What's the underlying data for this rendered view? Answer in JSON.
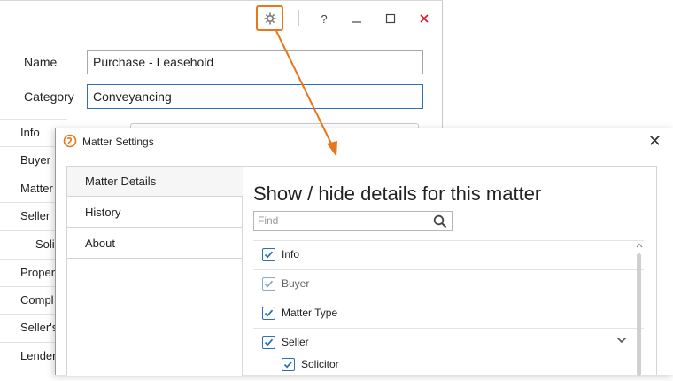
{
  "back_window": {
    "title_buttons": {
      "settings_icon": "gear-icon",
      "help_label": "?",
      "minimize_label": "—",
      "maximize_label": "☐",
      "close_label": "✕",
      "close_color": "#e81123"
    },
    "form": {
      "name_label": "Name",
      "name_value": "Purchase - Leasehold",
      "category_label": "Category",
      "category_value": "Conveyancing"
    },
    "left_list": [
      "Info",
      "Buyer",
      "Matter",
      "Seller",
      "Solic",
      "Proper",
      "Compl",
      "Seller's",
      "Lender"
    ]
  },
  "callout": {
    "color": "#e8761b"
  },
  "dialog": {
    "title": "Matter Settings",
    "close_label": "✕",
    "nav": [
      "Matter Details",
      "History",
      "About"
    ],
    "active_nav": "Matter Details",
    "heading": "Show / hide details for this matter",
    "find_placeholder": "Find",
    "details": [
      {
        "label": "Info",
        "checked": true,
        "dimmed": false
      },
      {
        "label": "Buyer",
        "checked": true,
        "dimmed": true
      },
      {
        "label": "Matter Type",
        "checked": true,
        "dimmed": false
      },
      {
        "label": "Seller",
        "checked": true,
        "dimmed": false,
        "expandable": true
      },
      {
        "label": "Solicitor",
        "checked": true,
        "dimmed": false,
        "indented": true
      }
    ],
    "accent_color": "#2f6fb3"
  }
}
